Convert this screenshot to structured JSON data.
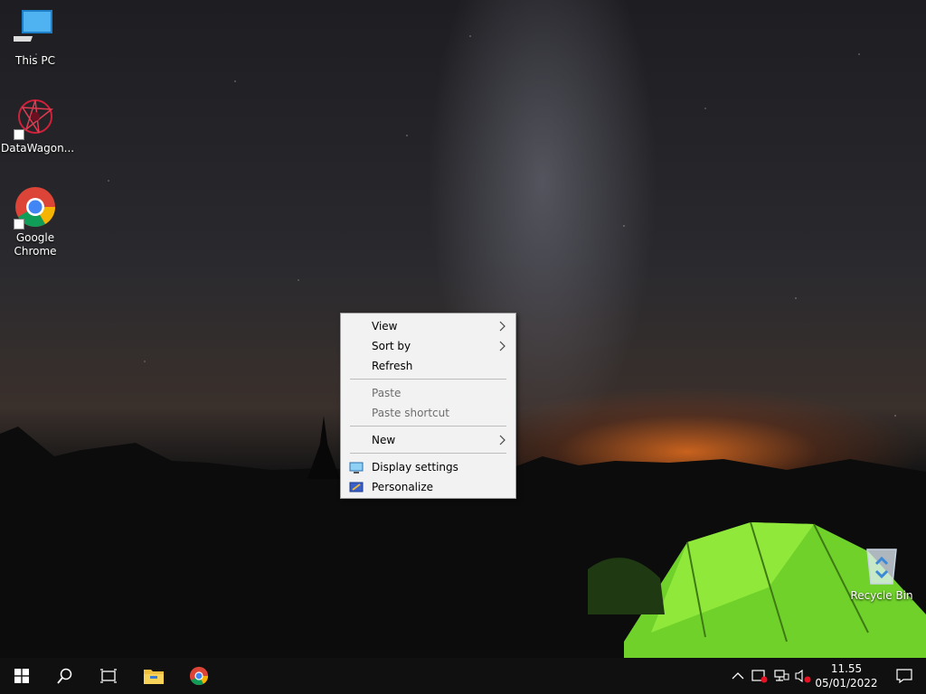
{
  "desktop": {
    "icons": [
      {
        "label": "This PC",
        "icon": "computer-icon"
      },
      {
        "label": "DataWagon...",
        "icon": "datawagon-icon"
      },
      {
        "label": "Google\nChrome",
        "icon": "chrome-icon"
      },
      {
        "label": "Recycle Bin",
        "icon": "recycle-bin-icon"
      }
    ]
  },
  "context_menu": {
    "view": "View",
    "sort_by": "Sort by",
    "refresh": "Refresh",
    "paste": "Paste",
    "paste_shortcut": "Paste shortcut",
    "new": "New",
    "display_settings": "Display settings",
    "personalize": "Personalize",
    "submenu_arrow": ">"
  },
  "taskbar": {
    "time": "11.55",
    "date": "05/01/2022",
    "tray_overflow": "^"
  },
  "colors": {
    "taskbar": "#101010",
    "menu_bg": "#f2f2f2",
    "folder": "#f0c040",
    "windows_blue": "#ffffff"
  }
}
